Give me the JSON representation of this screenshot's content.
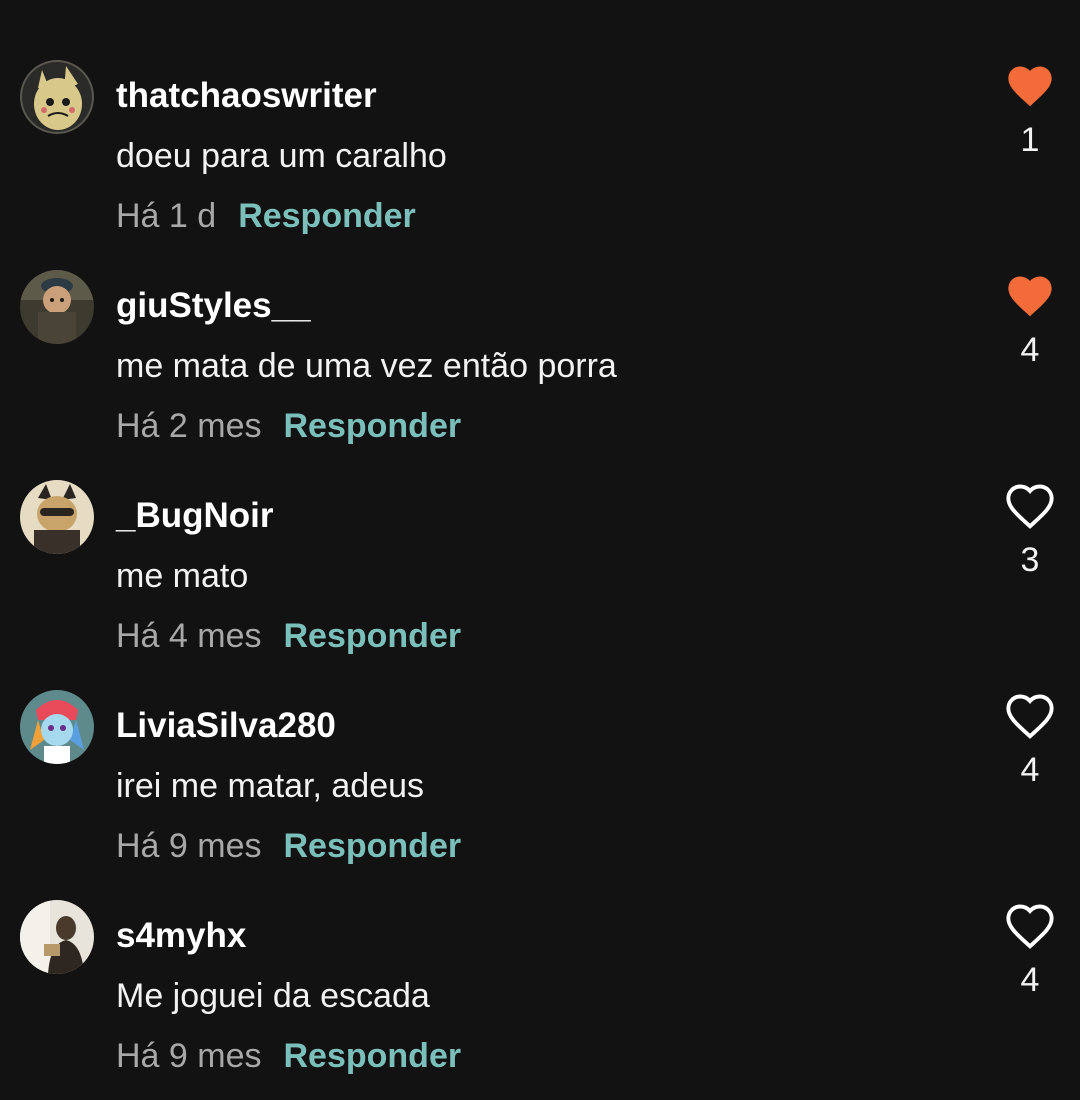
{
  "colors": {
    "background": "#121212",
    "liked_heart": "#f26b38",
    "reply_link": "#7bbfbb",
    "timestamp": "#a8a8a8"
  },
  "comments": [
    {
      "username": "thatchaoswriter",
      "text": "doeu para um caralho",
      "time": "Há 1 d",
      "reply_label": "Responder",
      "likes": "1",
      "liked": true,
      "avatar_icon": "mimikyu-avatar-icon"
    },
    {
      "username": "giuStyles__",
      "text": "me mata de uma vez então porra",
      "time": "Há 2 mes",
      "reply_label": "Responder",
      "likes": "4",
      "liked": true,
      "avatar_icon": "character-avatar-icon"
    },
    {
      "username": "_BugNoir",
      "text": "me mato",
      "time": "Há 4 mes",
      "reply_label": "Responder",
      "likes": "3",
      "liked": false,
      "avatar_icon": "cat-noir-avatar-icon"
    },
    {
      "username": "LiviaSilva280",
      "text": "irei me matar, adeus",
      "time": "Há 9 mes",
      "reply_label": "Responder",
      "likes": "4",
      "liked": false,
      "avatar_icon": "rainbow-character-avatar-icon"
    },
    {
      "username": "s4myhx",
      "text": "Me joguei da escada",
      "time": "Há 9 mes",
      "reply_label": "Responder",
      "likes": "4",
      "liked": false,
      "avatar_icon": "person-reading-avatar-icon"
    }
  ]
}
